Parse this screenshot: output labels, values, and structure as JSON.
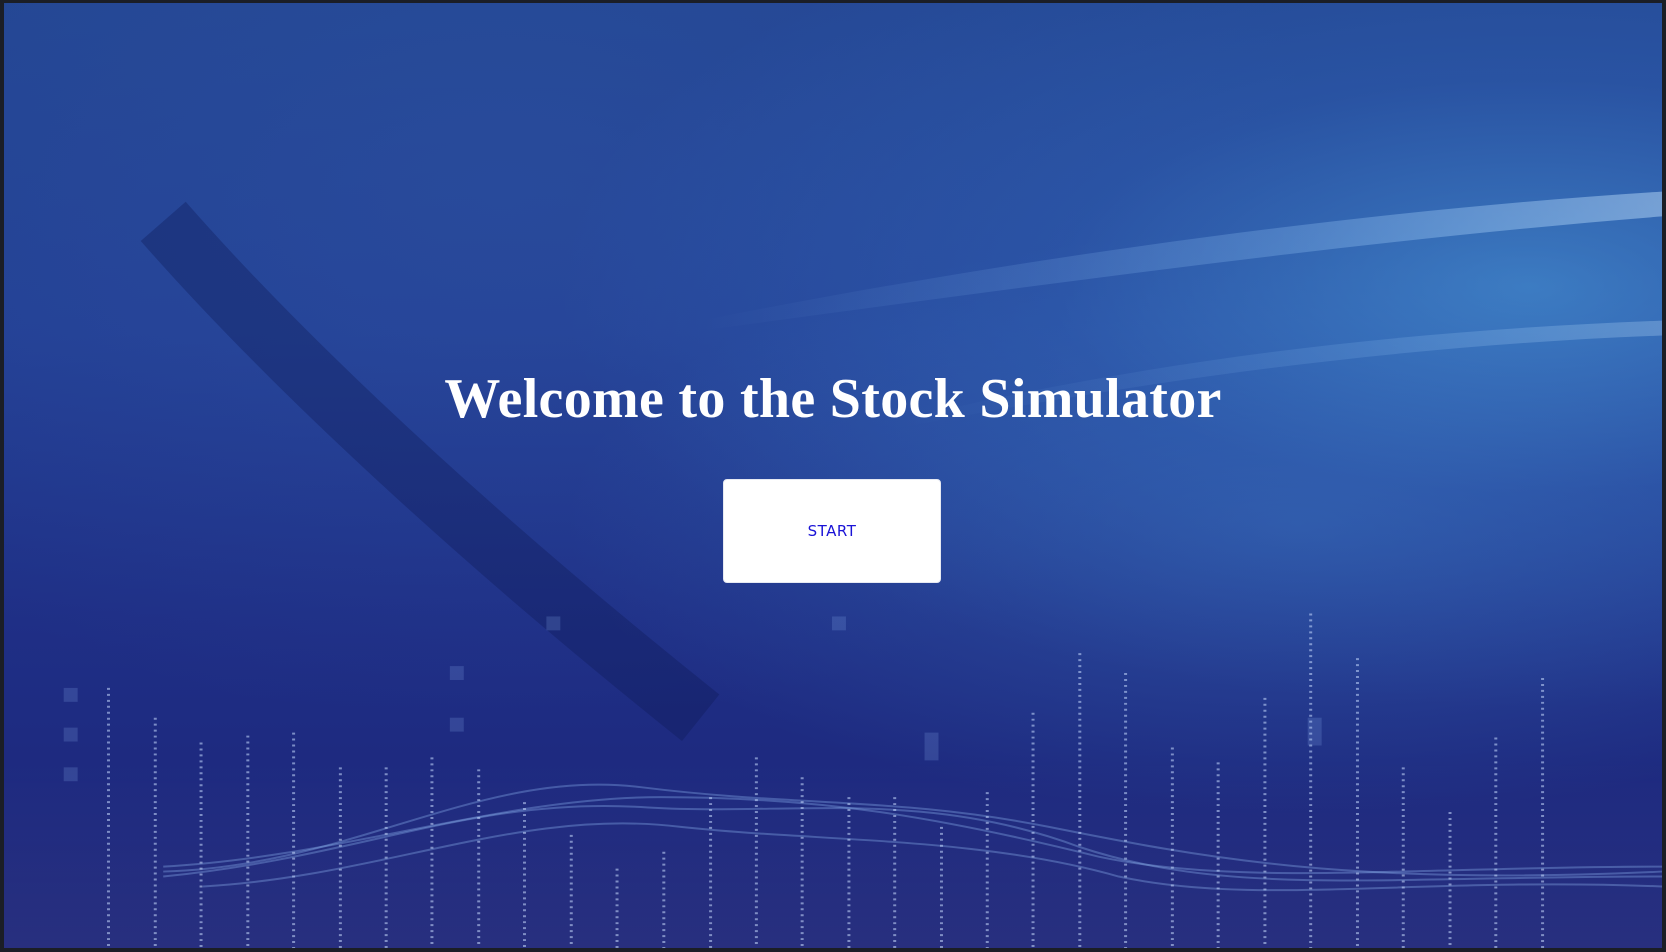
{
  "welcome": {
    "title": "Welcome to the Stock Simulator",
    "start_label": "START"
  },
  "colors": {
    "background": "#233f94",
    "title_text": "#ffffff",
    "button_background": "#ffffff",
    "button_text": "#1a13d6"
  }
}
